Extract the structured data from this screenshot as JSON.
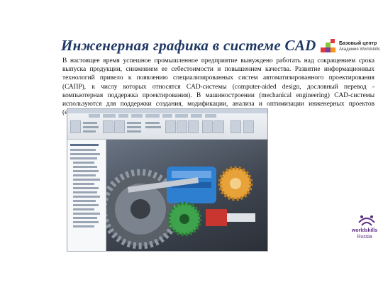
{
  "slide": {
    "title": "Инженерная графика в системе CAD",
    "paragraph": "В настоящее время успешное промышленное предприятие вынуждено работать над сокращением срока выпуска продукции, снижением ее себестоимости и повышением качества. Развитие информационных технологий привело к появлению специализированных систем автоматизированного проектирования (САПР), к числу которых относятся CAD-системы (computer-aided design, дословный перевод - компьютерная поддержка проектирования). В машиностроении (mechanical engineering) CAD-системы используются для поддержки создания, модификации, анализа и оптимизации инженерных проектов (engineering design)."
  },
  "logo": {
    "line1": "Базовый центр",
    "line2": "Академия Worldskills"
  },
  "footer_logo": {
    "line1": "worldskills",
    "line2": "Russia"
  },
  "colors": {
    "title": "#1f3864",
    "logo_red": "#e03a3e",
    "logo_green": "#8cc63f",
    "logo_purple": "#7a3f98",
    "logo_orange": "#f7941d",
    "gear_orange": "#e7a23a",
    "gear_green": "#3fa34d",
    "part_blue": "#2f7fd0",
    "part_red": "#c8362f"
  }
}
